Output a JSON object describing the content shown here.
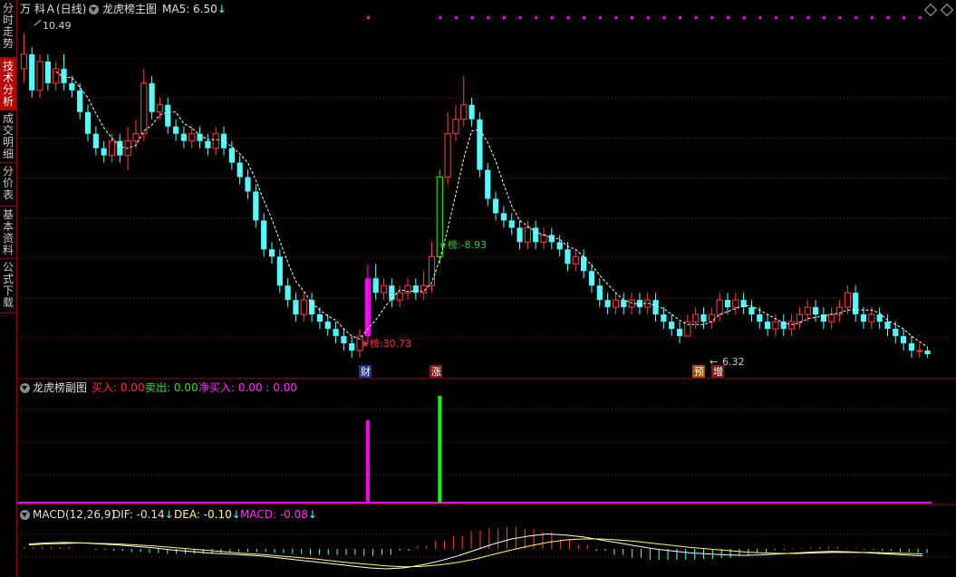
{
  "sidebar": {
    "tabs": [
      {
        "label": "分时走势",
        "active": false
      },
      {
        "label": "技术分析",
        "active": true
      },
      {
        "label": "成交明细",
        "active": false
      },
      {
        "label": "分价表",
        "active": false
      },
      {
        "label": "基本资料",
        "active": false
      },
      {
        "label": "公式下载",
        "active": false
      }
    ]
  },
  "main": {
    "stock_name": "万 科Ａ",
    "period": "(日线)",
    "indicator": "龙虎榜主图",
    "ma_label": "MA5: 6.50",
    "ma_arrow": "↓",
    "high_label": "10.49",
    "low_label": "6.32",
    "markers": [
      {
        "label": "★榜:30.73",
        "color": "#ff3030"
      },
      {
        "label": "★榜:-8.93",
        "color": "#30d030"
      }
    ],
    "badges": [
      {
        "label": "财",
        "bg": "#1a3a7a"
      },
      {
        "label": "涨",
        "bg": "#7a1a1a"
      },
      {
        "label": "预",
        "bg": "#a05000"
      },
      {
        "label": "增",
        "bg": "#7a1a1a"
      }
    ]
  },
  "sub_chart": {
    "title": "龙虎榜副图",
    "buy": "买入: 0.00",
    "sell": "卖出: 0.00",
    "net": "净买入: 0.00 : 0.00"
  },
  "macd": {
    "title": "MACD(12,26,9)",
    "dif": "DIF: -0.14",
    "dea": "DEA: -0.10",
    "macd": "MACD: -0.08",
    "arrow": "↓"
  },
  "colors": {
    "up": "#ff4040",
    "down": "#54ffff",
    "grid": "#8a1010",
    "ma": "#ffffff",
    "buy": "#ff00ff",
    "sell": "#00ff00",
    "dea_line": "#ffff60"
  },
  "chart_data": {
    "type": "candlestick",
    "y_range": [
      6.0,
      10.7
    ],
    "candles": [
      [
        10.0,
        10.2,
        10.49,
        9.8
      ],
      [
        10.2,
        9.7,
        10.3,
        9.6
      ],
      [
        9.7,
        10.1,
        10.2,
        9.6
      ],
      [
        10.1,
        9.8,
        10.2,
        9.7
      ],
      [
        9.8,
        10.0,
        10.1,
        9.7
      ],
      [
        10.0,
        9.8,
        10.2,
        9.7
      ],
      [
        9.8,
        9.7,
        9.9,
        9.6
      ],
      [
        9.7,
        9.4,
        9.8,
        9.3
      ],
      [
        9.4,
        9.1,
        9.5,
        9.0
      ],
      [
        9.1,
        8.9,
        9.2,
        8.8
      ],
      [
        8.9,
        8.8,
        9.0,
        8.7
      ],
      [
        8.8,
        9.0,
        9.1,
        8.7
      ],
      [
        9.0,
        8.8,
        9.1,
        8.7
      ],
      [
        8.8,
        9.0,
        9.2,
        8.6
      ],
      [
        9.0,
        9.1,
        9.3,
        8.9
      ],
      [
        9.1,
        9.8,
        10.0,
        9.0
      ],
      [
        9.8,
        9.4,
        9.9,
        9.3
      ],
      [
        9.4,
        9.5,
        9.6,
        9.3
      ],
      [
        9.5,
        9.2,
        9.6,
        9.1
      ],
      [
        9.2,
        9.1,
        9.3,
        9.0
      ],
      [
        9.1,
        9.0,
        9.2,
        8.9
      ],
      [
        9.0,
        9.1,
        9.2,
        8.9
      ],
      [
        9.1,
        9.0,
        9.2,
        8.9
      ],
      [
        9.0,
        8.9,
        9.1,
        8.8
      ],
      [
        8.9,
        9.1,
        9.2,
        8.8
      ],
      [
        9.1,
        8.9,
        9.2,
        8.8
      ],
      [
        8.9,
        8.7,
        9.0,
        8.6
      ],
      [
        8.7,
        8.5,
        8.8,
        8.4
      ],
      [
        8.5,
        8.3,
        8.6,
        8.2
      ],
      [
        8.3,
        7.9,
        8.4,
        7.8
      ],
      [
        7.9,
        7.5,
        8.0,
        7.4
      ],
      [
        7.5,
        7.4,
        7.6,
        7.3
      ],
      [
        7.4,
        7.0,
        7.5,
        6.9
      ],
      [
        7.0,
        6.8,
        7.1,
        6.7
      ],
      [
        6.8,
        6.6,
        6.9,
        6.5
      ],
      [
        6.6,
        6.8,
        6.9,
        6.5
      ],
      [
        6.8,
        6.6,
        6.9,
        6.5
      ],
      [
        6.6,
        6.5,
        6.7,
        6.4
      ],
      [
        6.5,
        6.4,
        6.6,
        6.3
      ],
      [
        6.4,
        6.3,
        6.5,
        6.2
      ],
      [
        6.3,
        6.2,
        6.4,
        6.1
      ],
      [
        6.2,
        6.1,
        6.3,
        6.0
      ],
      [
        6.1,
        6.3,
        6.4,
        6.0
      ],
      [
        6.3,
        7.1,
        7.3,
        6.2
      ],
      [
        7.1,
        6.9,
        7.3,
        6.8
      ],
      [
        6.9,
        7.0,
        7.1,
        6.8
      ],
      [
        7.0,
        6.8,
        7.1,
        6.7
      ],
      [
        6.8,
        6.9,
        7.0,
        6.7
      ],
      [
        6.9,
        7.0,
        7.1,
        6.8
      ],
      [
        7.0,
        6.9,
        7.1,
        6.8
      ],
      [
        6.9,
        7.0,
        7.2,
        6.8
      ],
      [
        7.0,
        7.4,
        7.6,
        6.9
      ],
      [
        7.4,
        8.5,
        8.6,
        7.3
      ],
      [
        8.5,
        9.1,
        9.4,
        8.4
      ],
      [
        9.1,
        9.3,
        9.5,
        9.0
      ],
      [
        9.3,
        9.5,
        9.9,
        9.2
      ],
      [
        9.5,
        9.3,
        9.6,
        9.2
      ],
      [
        9.3,
        8.6,
        9.4,
        8.5
      ],
      [
        8.6,
        8.2,
        8.7,
        8.1
      ],
      [
        8.2,
        8.0,
        8.3,
        7.9
      ],
      [
        8.0,
        7.9,
        8.1,
        7.8
      ],
      [
        7.9,
        7.8,
        8.0,
        7.7
      ],
      [
        7.8,
        7.6,
        7.9,
        7.5
      ],
      [
        7.6,
        7.8,
        7.9,
        7.5
      ],
      [
        7.8,
        7.6,
        7.9,
        7.5
      ],
      [
        7.6,
        7.7,
        7.8,
        7.5
      ],
      [
        7.7,
        7.6,
        7.8,
        7.5
      ],
      [
        7.6,
        7.5,
        7.7,
        7.4
      ],
      [
        7.5,
        7.3,
        7.6,
        7.2
      ],
      [
        7.3,
        7.4,
        7.5,
        7.2
      ],
      [
        7.4,
        7.2,
        7.5,
        7.1
      ],
      [
        7.2,
        7.0,
        7.3,
        6.9
      ],
      [
        7.0,
        6.8,
        7.1,
        6.7
      ],
      [
        6.8,
        6.7,
        6.9,
        6.6
      ],
      [
        6.7,
        6.8,
        6.9,
        6.6
      ],
      [
        6.8,
        6.7,
        6.9,
        6.6
      ],
      [
        6.7,
        6.8,
        6.9,
        6.6
      ],
      [
        6.8,
        6.7,
        6.9,
        6.6
      ],
      [
        6.7,
        6.8,
        6.9,
        6.6
      ],
      [
        6.8,
        6.6,
        6.9,
        6.5
      ],
      [
        6.6,
        6.5,
        6.7,
        6.4
      ],
      [
        6.5,
        6.4,
        6.6,
        6.3
      ],
      [
        6.4,
        6.3,
        6.5,
        6.2
      ],
      [
        6.3,
        6.5,
        6.6,
        6.32
      ],
      [
        6.5,
        6.6,
        6.7,
        6.4
      ],
      [
        6.6,
        6.5,
        6.7,
        6.4
      ],
      [
        6.5,
        6.6,
        6.7,
        6.4
      ],
      [
        6.6,
        6.8,
        6.9,
        6.5
      ],
      [
        6.8,
        6.7,
        6.9,
        6.6
      ],
      [
        6.7,
        6.8,
        6.9,
        6.6
      ],
      [
        6.8,
        6.7,
        6.9,
        6.6
      ],
      [
        6.7,
        6.6,
        6.8,
        6.5
      ],
      [
        6.6,
        6.5,
        6.7,
        6.4
      ],
      [
        6.5,
        6.4,
        6.6,
        6.3
      ],
      [
        6.4,
        6.5,
        6.6,
        6.3
      ],
      [
        6.5,
        6.4,
        6.6,
        6.3
      ],
      [
        6.4,
        6.5,
        6.6,
        6.3
      ],
      [
        6.5,
        6.6,
        6.7,
        6.4
      ],
      [
        6.6,
        6.7,
        6.8,
        6.5
      ],
      [
        6.7,
        6.6,
        6.8,
        6.5
      ],
      [
        6.6,
        6.5,
        6.7,
        6.4
      ],
      [
        6.5,
        6.6,
        6.7,
        6.4
      ],
      [
        6.6,
        6.7,
        6.8,
        6.5
      ],
      [
        6.7,
        6.9,
        7.0,
        6.6
      ],
      [
        6.9,
        6.6,
        7.0,
        6.5
      ],
      [
        6.6,
        6.5,
        6.7,
        6.4
      ],
      [
        6.5,
        6.6,
        6.7,
        6.4
      ],
      [
        6.6,
        6.5,
        6.7,
        6.4
      ],
      [
        6.5,
        6.4,
        6.6,
        6.3
      ],
      [
        6.4,
        6.3,
        6.5,
        6.2
      ],
      [
        6.3,
        6.2,
        6.4,
        6.1
      ],
      [
        6.2,
        6.1,
        6.3,
        6.0
      ],
      [
        6.1,
        6.1,
        6.2,
        6.0
      ],
      [
        6.1,
        6.05,
        6.15,
        6.0
      ]
    ],
    "buy_bar_index": 43,
    "sell_bar_index": 52,
    "dif": [
      0.1,
      0.12,
      0.13,
      0.12,
      0.1,
      0.08,
      0.05,
      0.02,
      -0.02,
      -0.05,
      -0.08,
      -0.1,
      -0.12,
      -0.14,
      -0.18,
      -0.22,
      -0.26,
      -0.3,
      -0.34,
      -0.38,
      -0.4,
      -0.38,
      -0.32,
      -0.24,
      -0.14,
      -0.02,
      0.1,
      0.2,
      0.26,
      0.3,
      0.28,
      0.24,
      0.18,
      0.12,
      0.06,
      0.0,
      -0.04,
      -0.08,
      -0.1,
      -0.12,
      -0.13,
      -0.12,
      -0.1,
      -0.08,
      -0.06,
      -0.05,
      -0.06,
      -0.08,
      -0.1,
      -0.12,
      -0.14
    ],
    "dea": [
      0.08,
      0.1,
      0.11,
      0.12,
      0.11,
      0.1,
      0.08,
      0.06,
      0.03,
      0.0,
      -0.03,
      -0.06,
      -0.09,
      -0.11,
      -0.14,
      -0.17,
      -0.2,
      -0.24,
      -0.28,
      -0.31,
      -0.34,
      -0.36,
      -0.35,
      -0.32,
      -0.27,
      -0.2,
      -0.11,
      -0.02,
      0.06,
      0.13,
      0.18,
      0.2,
      0.2,
      0.18,
      0.15,
      0.11,
      0.07,
      0.03,
      0.0,
      -0.03,
      -0.06,
      -0.08,
      -0.09,
      -0.09,
      -0.08,
      -0.07,
      -0.07,
      -0.07,
      -0.08,
      -0.09,
      -0.1
    ],
    "macd_hist": [
      0.04,
      0.04,
      0.04,
      0.0,
      -0.02,
      -0.04,
      -0.06,
      -0.08,
      -0.1,
      -0.1,
      -0.1,
      -0.08,
      -0.06,
      -0.06,
      -0.08,
      -0.1,
      -0.12,
      -0.12,
      -0.12,
      -0.14,
      -0.12,
      -0.04,
      0.06,
      0.16,
      0.26,
      0.36,
      0.42,
      0.44,
      0.4,
      0.34,
      0.2,
      0.08,
      -0.04,
      -0.12,
      -0.18,
      -0.22,
      -0.22,
      -0.22,
      -0.2,
      -0.18,
      -0.14,
      -0.08,
      -0.02,
      0.02,
      0.04,
      0.04,
      0.02,
      -0.02,
      -0.04,
      -0.06,
      -0.08
    ]
  }
}
